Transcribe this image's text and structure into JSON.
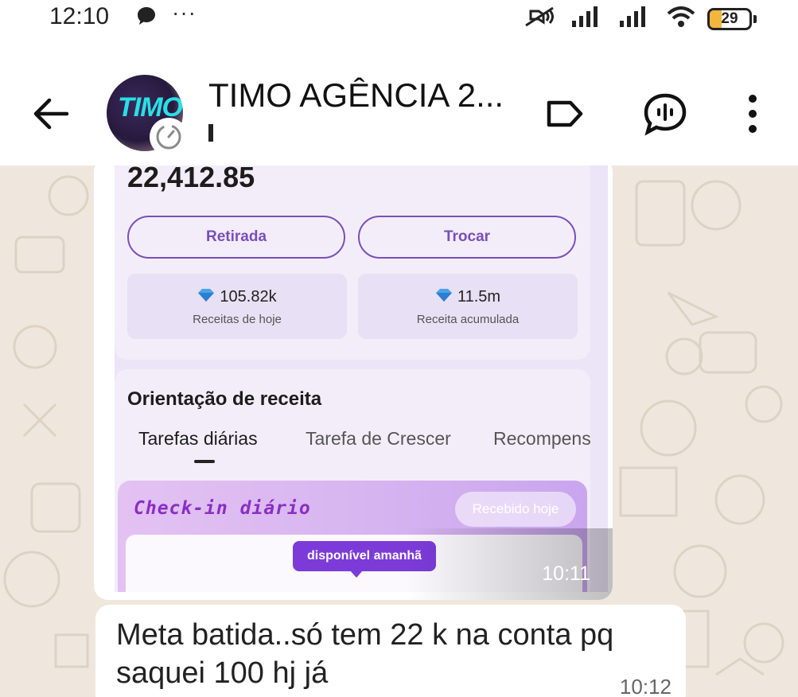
{
  "status_bar": {
    "time": "12:10",
    "notification_icons": [
      "chat-bubble-icon"
    ],
    "overflow": "···",
    "right_icons": [
      "mute-icon",
      "signal-icon",
      "signal-icon",
      "wifi-icon"
    ],
    "battery_level": "29",
    "battery_fraction": 0.29,
    "battery_color": "#f1b63c"
  },
  "header": {
    "contact_name": "TIMO AGÊNCIA 2...",
    "avatar_text": "TIMO",
    "icons": [
      "back-arrow-icon",
      "label-icon",
      "voice-chat-icon",
      "more-vert-icon"
    ]
  },
  "messages": {
    "image_message": {
      "time": "10:11",
      "screenshot": {
        "balance": "22,412.85",
        "withdraw_label": "Retirada",
        "exchange_label": "Trocar",
        "today_value": "105.82k",
        "today_label": "Receitas de hoje",
        "total_value": "11.5m",
        "total_label": "Receita acumulada",
        "guide_title": "Orientação de receita",
        "tabs": [
          "Tarefas diárias",
          "Tarefa de Crescer",
          "Recompens"
        ],
        "active_tab": "Tarefas diárias",
        "checkin_title": "Check-in diário",
        "received_label": "Recebido hoje",
        "tooltip": "disponível amanhã"
      }
    },
    "text_message": {
      "text": "Meta batida..só tem 22 k na conta pq saquei 100 hj já",
      "time": "10:12"
    }
  },
  "colors": {
    "chat_background": "#efe7de",
    "accent_purple": "#7a4fb8",
    "tooltip_purple": "#7c3bd9"
  }
}
